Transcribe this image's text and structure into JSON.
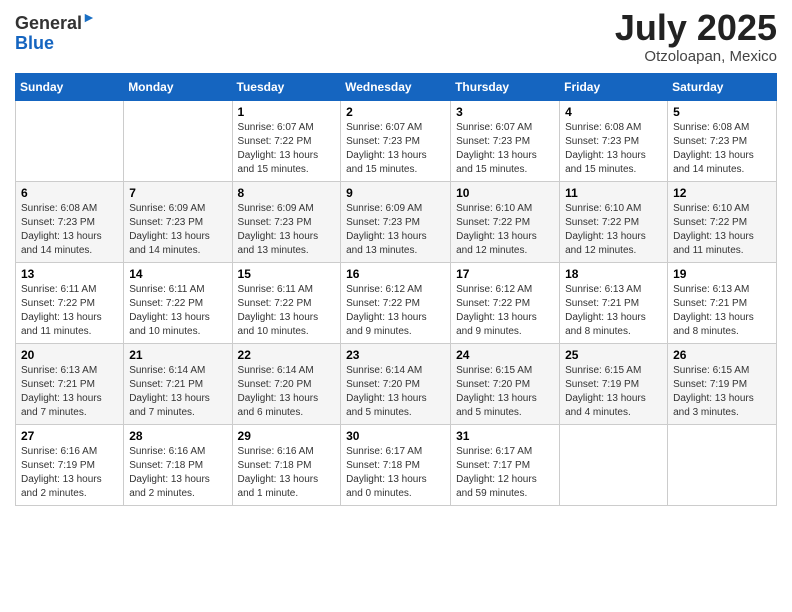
{
  "header": {
    "logo_general": "General",
    "logo_blue": "Blue",
    "month_title": "July 2025",
    "location": "Otzoloapan, Mexico"
  },
  "days_of_week": [
    "Sunday",
    "Monday",
    "Tuesday",
    "Wednesday",
    "Thursday",
    "Friday",
    "Saturday"
  ],
  "weeks": [
    [
      {
        "day": "",
        "sunrise": "",
        "sunset": "",
        "daylight": ""
      },
      {
        "day": "",
        "sunrise": "",
        "sunset": "",
        "daylight": ""
      },
      {
        "day": "1",
        "sunrise": "Sunrise: 6:07 AM",
        "sunset": "Sunset: 7:22 PM",
        "daylight": "Daylight: 13 hours and 15 minutes."
      },
      {
        "day": "2",
        "sunrise": "Sunrise: 6:07 AM",
        "sunset": "Sunset: 7:23 PM",
        "daylight": "Daylight: 13 hours and 15 minutes."
      },
      {
        "day": "3",
        "sunrise": "Sunrise: 6:07 AM",
        "sunset": "Sunset: 7:23 PM",
        "daylight": "Daylight: 13 hours and 15 minutes."
      },
      {
        "day": "4",
        "sunrise": "Sunrise: 6:08 AM",
        "sunset": "Sunset: 7:23 PM",
        "daylight": "Daylight: 13 hours and 15 minutes."
      },
      {
        "day": "5",
        "sunrise": "Sunrise: 6:08 AM",
        "sunset": "Sunset: 7:23 PM",
        "daylight": "Daylight: 13 hours and 14 minutes."
      }
    ],
    [
      {
        "day": "6",
        "sunrise": "Sunrise: 6:08 AM",
        "sunset": "Sunset: 7:23 PM",
        "daylight": "Daylight: 13 hours and 14 minutes."
      },
      {
        "day": "7",
        "sunrise": "Sunrise: 6:09 AM",
        "sunset": "Sunset: 7:23 PM",
        "daylight": "Daylight: 13 hours and 14 minutes."
      },
      {
        "day": "8",
        "sunrise": "Sunrise: 6:09 AM",
        "sunset": "Sunset: 7:23 PM",
        "daylight": "Daylight: 13 hours and 13 minutes."
      },
      {
        "day": "9",
        "sunrise": "Sunrise: 6:09 AM",
        "sunset": "Sunset: 7:23 PM",
        "daylight": "Daylight: 13 hours and 13 minutes."
      },
      {
        "day": "10",
        "sunrise": "Sunrise: 6:10 AM",
        "sunset": "Sunset: 7:22 PM",
        "daylight": "Daylight: 13 hours and 12 minutes."
      },
      {
        "day": "11",
        "sunrise": "Sunrise: 6:10 AM",
        "sunset": "Sunset: 7:22 PM",
        "daylight": "Daylight: 13 hours and 12 minutes."
      },
      {
        "day": "12",
        "sunrise": "Sunrise: 6:10 AM",
        "sunset": "Sunset: 7:22 PM",
        "daylight": "Daylight: 13 hours and 11 minutes."
      }
    ],
    [
      {
        "day": "13",
        "sunrise": "Sunrise: 6:11 AM",
        "sunset": "Sunset: 7:22 PM",
        "daylight": "Daylight: 13 hours and 11 minutes."
      },
      {
        "day": "14",
        "sunrise": "Sunrise: 6:11 AM",
        "sunset": "Sunset: 7:22 PM",
        "daylight": "Daylight: 13 hours and 10 minutes."
      },
      {
        "day": "15",
        "sunrise": "Sunrise: 6:11 AM",
        "sunset": "Sunset: 7:22 PM",
        "daylight": "Daylight: 13 hours and 10 minutes."
      },
      {
        "day": "16",
        "sunrise": "Sunrise: 6:12 AM",
        "sunset": "Sunset: 7:22 PM",
        "daylight": "Daylight: 13 hours and 9 minutes."
      },
      {
        "day": "17",
        "sunrise": "Sunrise: 6:12 AM",
        "sunset": "Sunset: 7:22 PM",
        "daylight": "Daylight: 13 hours and 9 minutes."
      },
      {
        "day": "18",
        "sunrise": "Sunrise: 6:13 AM",
        "sunset": "Sunset: 7:21 PM",
        "daylight": "Daylight: 13 hours and 8 minutes."
      },
      {
        "day": "19",
        "sunrise": "Sunrise: 6:13 AM",
        "sunset": "Sunset: 7:21 PM",
        "daylight": "Daylight: 13 hours and 8 minutes."
      }
    ],
    [
      {
        "day": "20",
        "sunrise": "Sunrise: 6:13 AM",
        "sunset": "Sunset: 7:21 PM",
        "daylight": "Daylight: 13 hours and 7 minutes."
      },
      {
        "day": "21",
        "sunrise": "Sunrise: 6:14 AM",
        "sunset": "Sunset: 7:21 PM",
        "daylight": "Daylight: 13 hours and 7 minutes."
      },
      {
        "day": "22",
        "sunrise": "Sunrise: 6:14 AM",
        "sunset": "Sunset: 7:20 PM",
        "daylight": "Daylight: 13 hours and 6 minutes."
      },
      {
        "day": "23",
        "sunrise": "Sunrise: 6:14 AM",
        "sunset": "Sunset: 7:20 PM",
        "daylight": "Daylight: 13 hours and 5 minutes."
      },
      {
        "day": "24",
        "sunrise": "Sunrise: 6:15 AM",
        "sunset": "Sunset: 7:20 PM",
        "daylight": "Daylight: 13 hours and 5 minutes."
      },
      {
        "day": "25",
        "sunrise": "Sunrise: 6:15 AM",
        "sunset": "Sunset: 7:19 PM",
        "daylight": "Daylight: 13 hours and 4 minutes."
      },
      {
        "day": "26",
        "sunrise": "Sunrise: 6:15 AM",
        "sunset": "Sunset: 7:19 PM",
        "daylight": "Daylight: 13 hours and 3 minutes."
      }
    ],
    [
      {
        "day": "27",
        "sunrise": "Sunrise: 6:16 AM",
        "sunset": "Sunset: 7:19 PM",
        "daylight": "Daylight: 13 hours and 2 minutes."
      },
      {
        "day": "28",
        "sunrise": "Sunrise: 6:16 AM",
        "sunset": "Sunset: 7:18 PM",
        "daylight": "Daylight: 13 hours and 2 minutes."
      },
      {
        "day": "29",
        "sunrise": "Sunrise: 6:16 AM",
        "sunset": "Sunset: 7:18 PM",
        "daylight": "Daylight: 13 hours and 1 minute."
      },
      {
        "day": "30",
        "sunrise": "Sunrise: 6:17 AM",
        "sunset": "Sunset: 7:18 PM",
        "daylight": "Daylight: 13 hours and 0 minutes."
      },
      {
        "day": "31",
        "sunrise": "Sunrise: 6:17 AM",
        "sunset": "Sunset: 7:17 PM",
        "daylight": "Daylight: 12 hours and 59 minutes."
      },
      {
        "day": "",
        "sunrise": "",
        "sunset": "",
        "daylight": ""
      },
      {
        "day": "",
        "sunrise": "",
        "sunset": "",
        "daylight": ""
      }
    ]
  ]
}
